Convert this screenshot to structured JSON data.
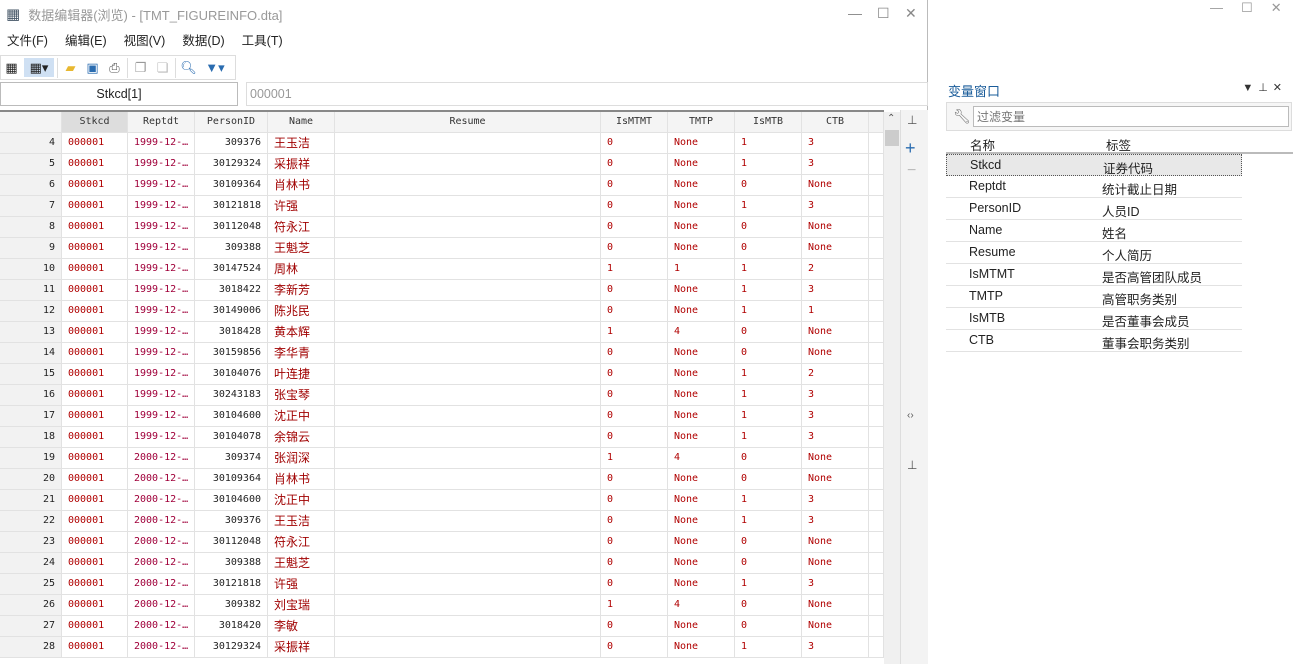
{
  "window": {
    "title": "数据编辑器(浏览) - [TMT_FIGUREINFO.dta]"
  },
  "menu": [
    "文件(F)",
    "编辑(E)",
    "视图(V)",
    "数据(D)",
    "工具(T)"
  ],
  "cellbar": {
    "name": "Stkcd[1]",
    "value": "000001"
  },
  "columns": [
    "Stkcd",
    "Reptdt",
    "PersonID",
    "Name",
    "Resume",
    "IsMTMT",
    "TMTP",
    "IsMTB",
    "CTB"
  ],
  "rows": [
    [
      "4",
      "000001",
      "1999-12-…",
      "309376",
      "王玉洁",
      "",
      "0",
      "None",
      "1",
      "3"
    ],
    [
      "5",
      "000001",
      "1999-12-…",
      "30129324",
      "采振祥",
      "",
      "0",
      "None",
      "1",
      "3"
    ],
    [
      "6",
      "000001",
      "1999-12-…",
      "30109364",
      "肖林书",
      "",
      "0",
      "None",
      "0",
      "None"
    ],
    [
      "7",
      "000001",
      "1999-12-…",
      "30121818",
      "许强",
      "",
      "0",
      "None",
      "1",
      "3"
    ],
    [
      "8",
      "000001",
      "1999-12-…",
      "30112048",
      "符永江",
      "",
      "0",
      "None",
      "0",
      "None"
    ],
    [
      "9",
      "000001",
      "1999-12-…",
      "309388",
      "王魁芝",
      "",
      "0",
      "None",
      "0",
      "None"
    ],
    [
      "10",
      "000001",
      "1999-12-…",
      "30147524",
      "周林",
      "",
      "1",
      "1",
      "1",
      "2"
    ],
    [
      "11",
      "000001",
      "1999-12-…",
      "3018422",
      "李新芳",
      "",
      "0",
      "None",
      "1",
      "3"
    ],
    [
      "12",
      "000001",
      "1999-12-…",
      "30149006",
      "陈兆民",
      "",
      "0",
      "None",
      "1",
      "1"
    ],
    [
      "13",
      "000001",
      "1999-12-…",
      "3018428",
      "黄本辉",
      "",
      "1",
      "4",
      "0",
      "None"
    ],
    [
      "14",
      "000001",
      "1999-12-…",
      "30159856",
      "李华青",
      "",
      "0",
      "None",
      "0",
      "None"
    ],
    [
      "15",
      "000001",
      "1999-12-…",
      "30104076",
      "叶连捷",
      "",
      "0",
      "None",
      "1",
      "2"
    ],
    [
      "16",
      "000001",
      "1999-12-…",
      "30243183",
      "张宝琴",
      "",
      "0",
      "None",
      "1",
      "3"
    ],
    [
      "17",
      "000001",
      "1999-12-…",
      "30104600",
      "沈正中",
      "",
      "0",
      "None",
      "1",
      "3"
    ],
    [
      "18",
      "000001",
      "1999-12-…",
      "30104078",
      "余锦云",
      "",
      "0",
      "None",
      "1",
      "3"
    ],
    [
      "19",
      "000001",
      "2000-12-…",
      "309374",
      "张润深",
      "",
      "1",
      "4",
      "0",
      "None"
    ],
    [
      "20",
      "000001",
      "2000-12-…",
      "30109364",
      "肖林书",
      "",
      "0",
      "None",
      "0",
      "None"
    ],
    [
      "21",
      "000001",
      "2000-12-…",
      "30104600",
      "沈正中",
      "",
      "0",
      "None",
      "1",
      "3"
    ],
    [
      "22",
      "000001",
      "2000-12-…",
      "309376",
      "王玉洁",
      "",
      "0",
      "None",
      "1",
      "3"
    ],
    [
      "23",
      "000001",
      "2000-12-…",
      "30112048",
      "符永江",
      "",
      "0",
      "None",
      "0",
      "None"
    ],
    [
      "24",
      "000001",
      "2000-12-…",
      "309388",
      "王魁芝",
      "",
      "0",
      "None",
      "0",
      "None"
    ],
    [
      "25",
      "000001",
      "2000-12-…",
      "30121818",
      "许强",
      "",
      "0",
      "None",
      "1",
      "3"
    ],
    [
      "26",
      "000001",
      "2000-12-…",
      "309382",
      "刘宝瑞",
      "",
      "1",
      "4",
      "0",
      "None"
    ],
    [
      "27",
      "000001",
      "2000-12-…",
      "3018420",
      "李敏",
      "",
      "0",
      "None",
      "0",
      "None"
    ],
    [
      "28",
      "000001",
      "2000-12-…",
      "30129324",
      "采振祥",
      "",
      "0",
      "None",
      "1",
      "3"
    ]
  ],
  "var_panel": {
    "title": "变量窗口",
    "filter_placeholder": "过滤变量",
    "col_name": "名称",
    "col_label": "标签",
    "vars": [
      [
        "Stkcd",
        "证券代码"
      ],
      [
        "Reptdt",
        "统计截止日期"
      ],
      [
        "PersonID",
        "人员ID"
      ],
      [
        "Name",
        "姓名"
      ],
      [
        "Resume",
        "个人简历"
      ],
      [
        "IsMTMT",
        "是否高管团队成员"
      ],
      [
        "TMTP",
        "高管职务类别"
      ],
      [
        "IsMTB",
        "是否董事会成员"
      ],
      [
        "CTB",
        "董事会职务类别"
      ]
    ]
  }
}
